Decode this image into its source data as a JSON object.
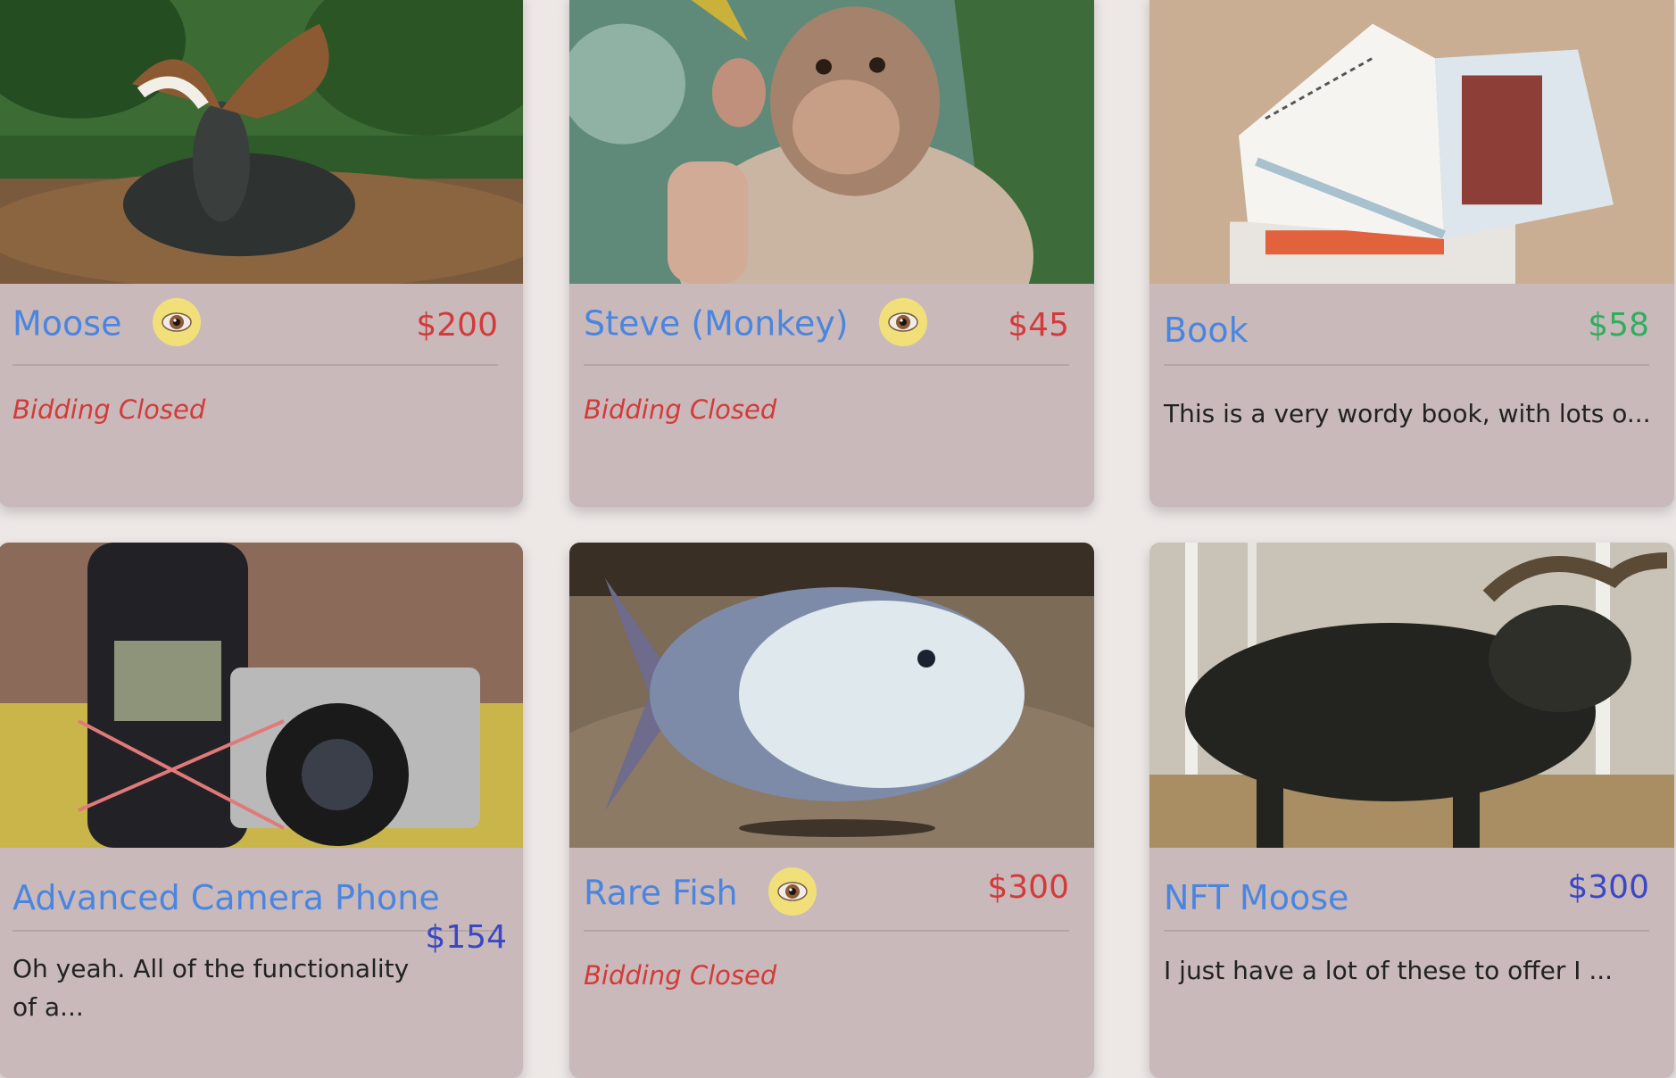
{
  "cards": [
    {
      "title": "Moose",
      "price": "$200",
      "status": "Bidding Closed",
      "watched": true,
      "image": "moose-photo",
      "price_color": "#d43a3a"
    },
    {
      "title": "Steve (Monkey)",
      "price": "$45",
      "status": "Bidding Closed",
      "watched": true,
      "image": "monkey-photo",
      "price_color": "#d43a3a"
    },
    {
      "title": "Book",
      "price": "$58",
      "description": "This is a very wordy book, with lots o...",
      "watched": false,
      "image": "book-photo",
      "price_color": "#2fae60"
    },
    {
      "title": "Advanced Camera Phone",
      "price": "$154",
      "description_line1": "Oh yeah. All of the functionality",
      "description_line2": "of a...",
      "watched": false,
      "image": "camera-phone-photo",
      "price_color": "#3a48c4"
    },
    {
      "title": "Rare Fish",
      "price": "$300",
      "status": "Bidding Closed",
      "watched": true,
      "image": "fish-photo",
      "price_color": "#d43a3a"
    },
    {
      "title": "NFT Moose",
      "price": "$300",
      "description": "I just have a lot of these to offer I ...",
      "watched": false,
      "image": "nft-moose-photo",
      "price_color": "#3a48c4"
    }
  ]
}
